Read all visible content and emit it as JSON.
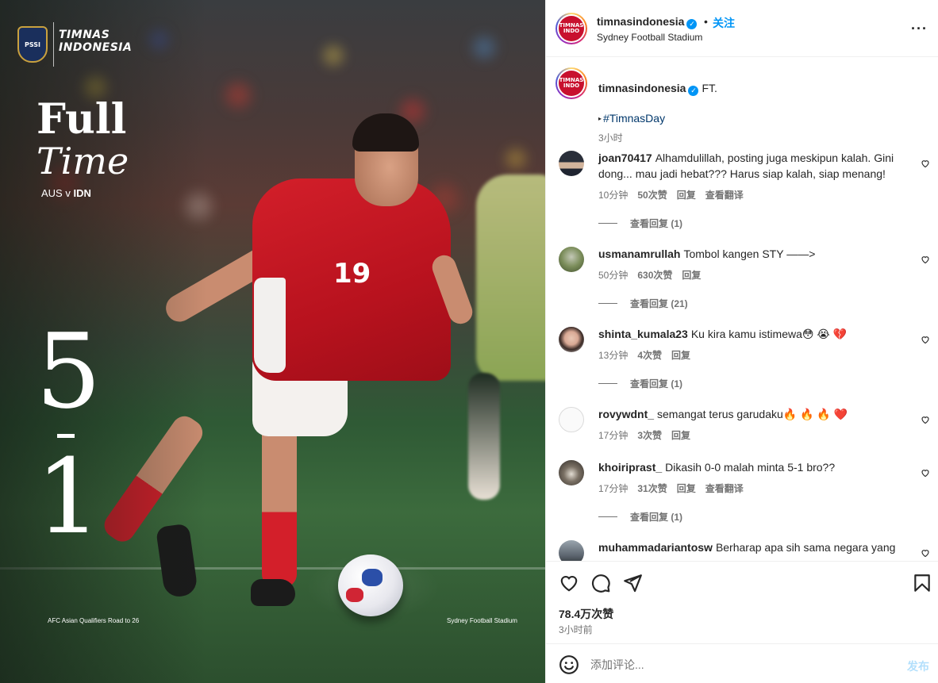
{
  "media": {
    "logo_badge": "PSSI",
    "logo_text": "TIMNAS INDONESIA",
    "title_line1": "Full",
    "title_line2": "Time",
    "match_home": "AUS",
    "match_sep": "v",
    "match_away": "IDN",
    "score_home": "5",
    "score_away": "1",
    "footer_left": "AFC Asian Qualifiers Road to 26",
    "footer_right": "Sydney Football Stadium",
    "shirt_number": "19"
  },
  "header": {
    "username": "timnasindonesia",
    "dot": "•",
    "follow_label": "关注",
    "location": "Sydney Football Stadium",
    "more": "···"
  },
  "caption": {
    "username": "timnasindonesia",
    "text": "FT.",
    "hashtag": "#TimnasDay",
    "time": "3小时"
  },
  "comments": [
    {
      "username": "joan70417",
      "text": "Alhamdulillah, posting juga meskipun kalah. Gini dong... mau jadi hebat??? Harus siap kalah, siap menang!",
      "time": "10分钟",
      "likes": "50次赞",
      "reply": "回复",
      "translate": "查看翻译",
      "replies": "查看回复 (1)"
    },
    {
      "username": "usmanamrullah",
      "text": "Tombol kangen STY ——>",
      "time": "50分钟",
      "likes": "630次赞",
      "reply": "回复",
      "translate": "",
      "replies": "查看回复 (21)"
    },
    {
      "username": "shinta_kumala23",
      "text": "Ku kira kamu istimewa😳 😭 💔",
      "time": "13分钟",
      "likes": "4次赞",
      "reply": "回复",
      "translate": "",
      "replies": "查看回复 (1)"
    },
    {
      "username": "rovywdnt_",
      "text": "semangat terus garudaku🔥 🔥 🔥 ❤️",
      "time": "17分钟",
      "likes": "3次赞",
      "reply": "回复",
      "translate": "",
      "replies": ""
    },
    {
      "username": "khoiriprast_",
      "text": "Dikasih 0-0 malah minta 5-1 bro??",
      "time": "17分钟",
      "likes": "31次赞",
      "reply": "回复",
      "translate": "查看翻译",
      "replies": "查看回复 (1)"
    },
    {
      "username": "muhammadariantosw",
      "text": "Berharap apa sih sama negara yang",
      "time": "",
      "likes": "",
      "reply": "",
      "translate": "",
      "replies": ""
    }
  ],
  "actions": {
    "like_icon": "heart-icon",
    "comment_icon": "comment-icon",
    "share_icon": "send-icon",
    "save_icon": "bookmark-icon",
    "likes": "78.4万次赞",
    "posted": "3小时前"
  },
  "add_comment": {
    "placeholder": "添加评论...",
    "post_label": "发布",
    "emoji_icon": "emoji-icon"
  },
  "colors": {
    "accent": "#0095f6",
    "link": "#00376b",
    "muted": "#737373",
    "post_disabled": "#b2dffc"
  }
}
